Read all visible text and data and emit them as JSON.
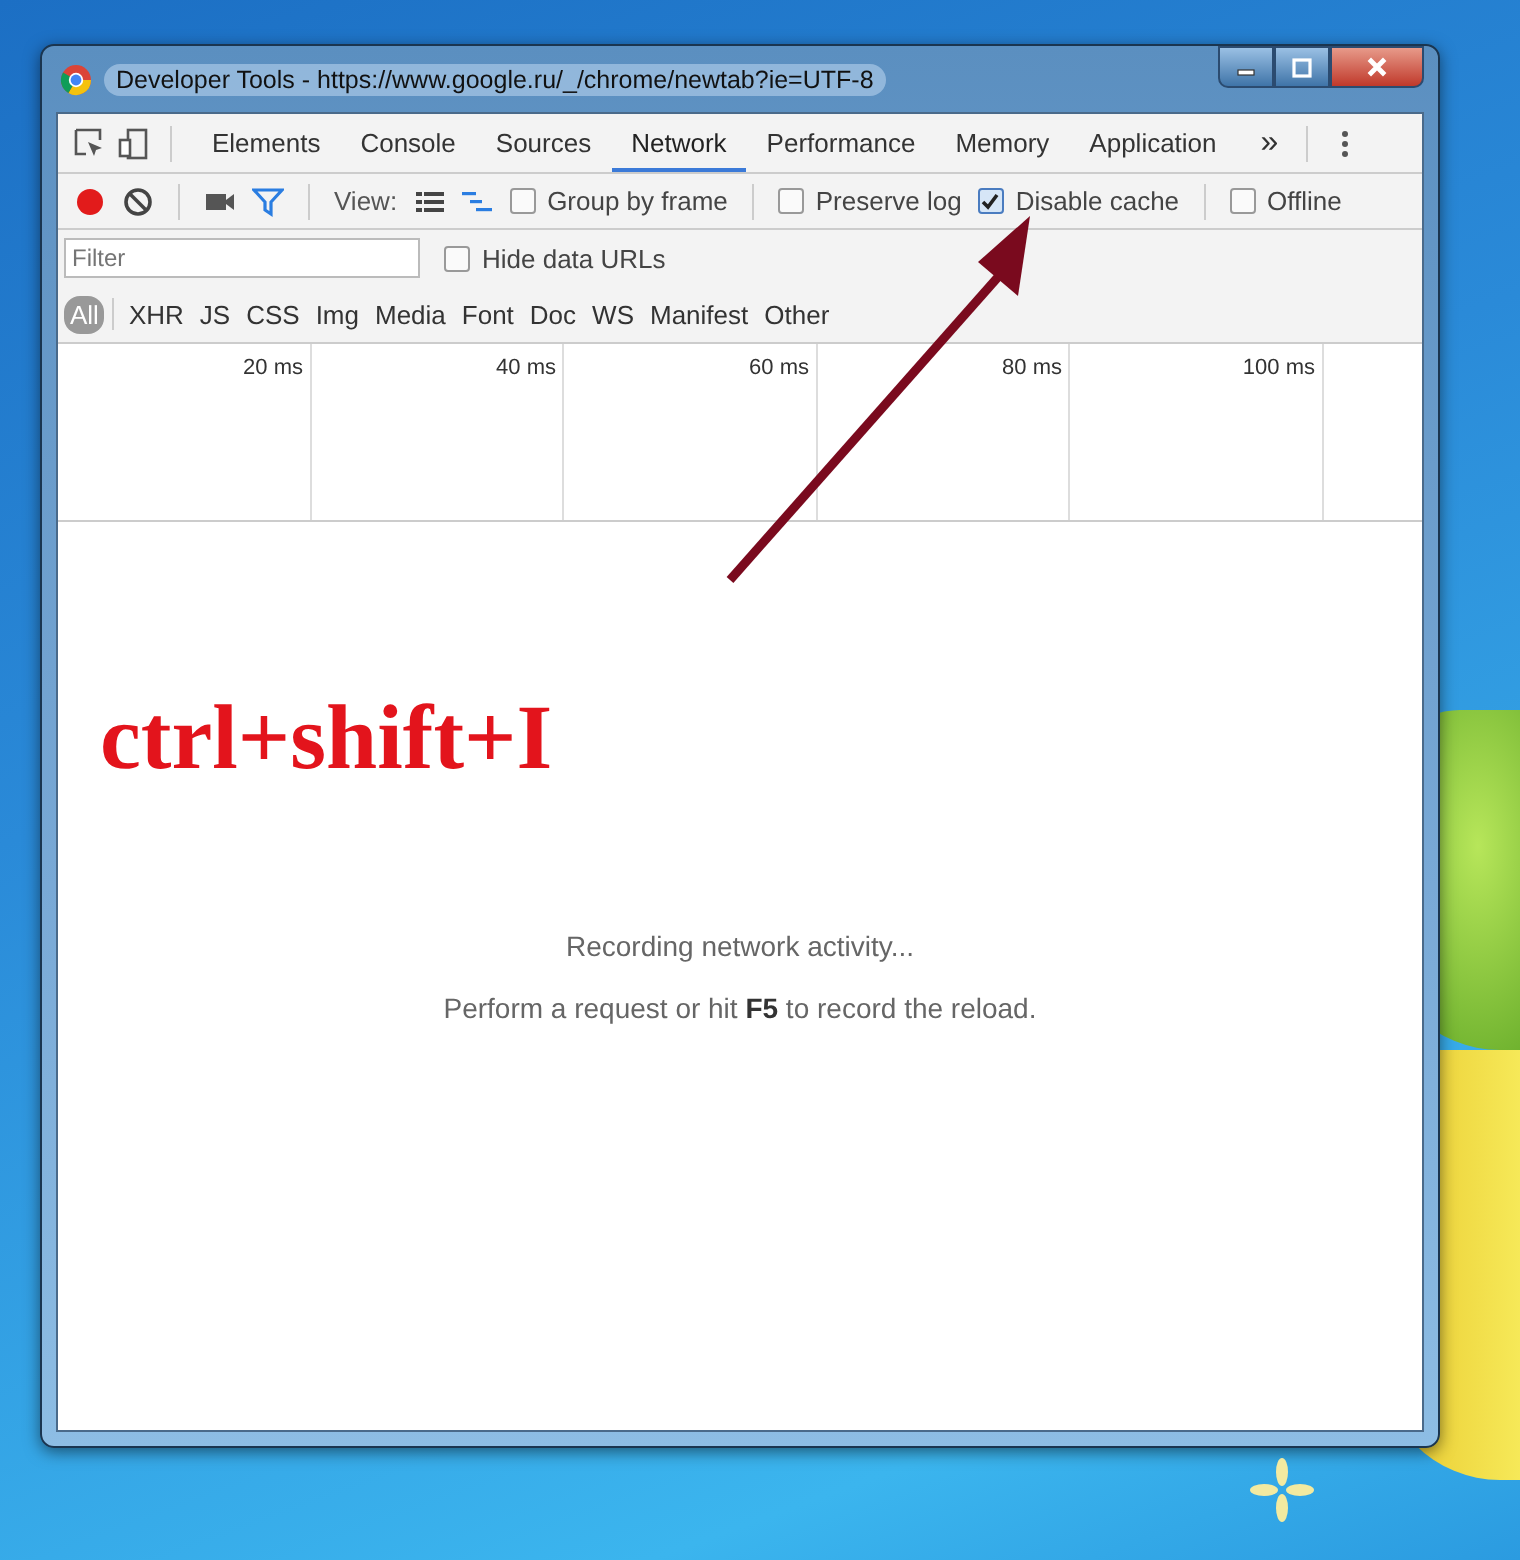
{
  "window": {
    "title": "Developer Tools - https://www.google.ru/_/chrome/newtab?ie=UTF-8"
  },
  "panel_tabs": [
    {
      "label": "Elements",
      "selected": false
    },
    {
      "label": "Console",
      "selected": false
    },
    {
      "label": "Sources",
      "selected": false
    },
    {
      "label": "Network",
      "selected": true
    },
    {
      "label": "Performance",
      "selected": false
    },
    {
      "label": "Memory",
      "selected": false
    },
    {
      "label": "Application",
      "selected": false
    }
  ],
  "overflow": "»",
  "network_toolbar": {
    "recording": true,
    "view_label": "View:",
    "options": [
      {
        "label": "Group by frame",
        "checked": false
      },
      {
        "label": "Preserve log",
        "checked": false
      },
      {
        "label": "Disable cache",
        "checked": true
      },
      {
        "label": "Offline",
        "checked": false
      }
    ]
  },
  "filter": {
    "placeholder": "Filter",
    "hide_data_urls": {
      "label": "Hide data URLs",
      "checked": false
    }
  },
  "type_filters": [
    {
      "label": "All",
      "selected": true
    },
    {
      "label": "XHR",
      "selected": false
    },
    {
      "label": "JS",
      "selected": false
    },
    {
      "label": "CSS",
      "selected": false
    },
    {
      "label": "Img",
      "selected": false
    },
    {
      "label": "Media",
      "selected": false
    },
    {
      "label": "Font",
      "selected": false
    },
    {
      "label": "Doc",
      "selected": false
    },
    {
      "label": "WS",
      "selected": false
    },
    {
      "label": "Manifest",
      "selected": false
    },
    {
      "label": "Other",
      "selected": false
    }
  ],
  "timeline_ticks": [
    "20 ms",
    "40 ms",
    "60 ms",
    "80 ms",
    "100 ms"
  ],
  "empty_state": {
    "title": "Recording network activity...",
    "hint": "Perform a request or hit **F5** to record the reload."
  },
  "annotation": {
    "text": "ctrl+shift+I"
  }
}
